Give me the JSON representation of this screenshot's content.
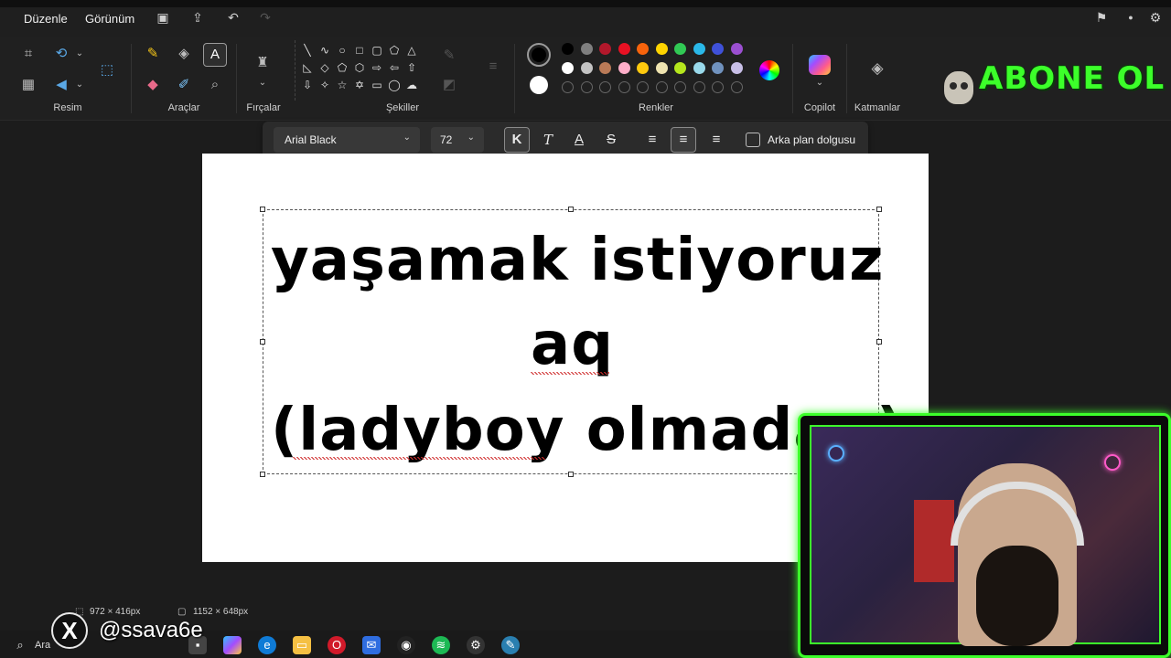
{
  "menubar": {
    "items": [
      "Düzenle",
      "Görünüm"
    ]
  },
  "ribbon": {
    "groups": {
      "image": "Resim",
      "tools": "Araçlar",
      "brushes": "Fırçalar",
      "shapes": "Şekiller",
      "colors": "Renkler",
      "copilot": "Copilot",
      "layers": "Katmanlar"
    },
    "palette_row1": [
      "#000000",
      "#7f7f7f",
      "#b2182b",
      "#e81123",
      "#f7630c",
      "#ffd400",
      "#31c954",
      "#2ab8e8",
      "#3f51d9",
      "#9b4fd1"
    ],
    "palette_row2": [
      "#ffffff",
      "#c3c3c3",
      "#b97a57",
      "#ffaec9",
      "#ffc90e",
      "#efe4b0",
      "#b5e61d",
      "#99d9ea",
      "#7092be",
      "#c8bfe7"
    ],
    "active_primary": "#000000",
    "active_secondary": "#ffffff"
  },
  "text_toolbar": {
    "font": "Arial Black",
    "size": "72",
    "background_fill_label": "Arka plan dolgusu"
  },
  "canvas": {
    "lines": [
      "yaşamak istiyoruz",
      "aq",
      "(ladyboy olmadan)"
    ]
  },
  "status": {
    "selection_size": "972 × 416px",
    "canvas_size": "1152 × 648px"
  },
  "taskbar": {
    "search_label": "Ara"
  },
  "overlay": {
    "subscribe_text": "ABONE OL",
    "social_handle": "@ssava6e",
    "social_icon": "x-logo"
  }
}
